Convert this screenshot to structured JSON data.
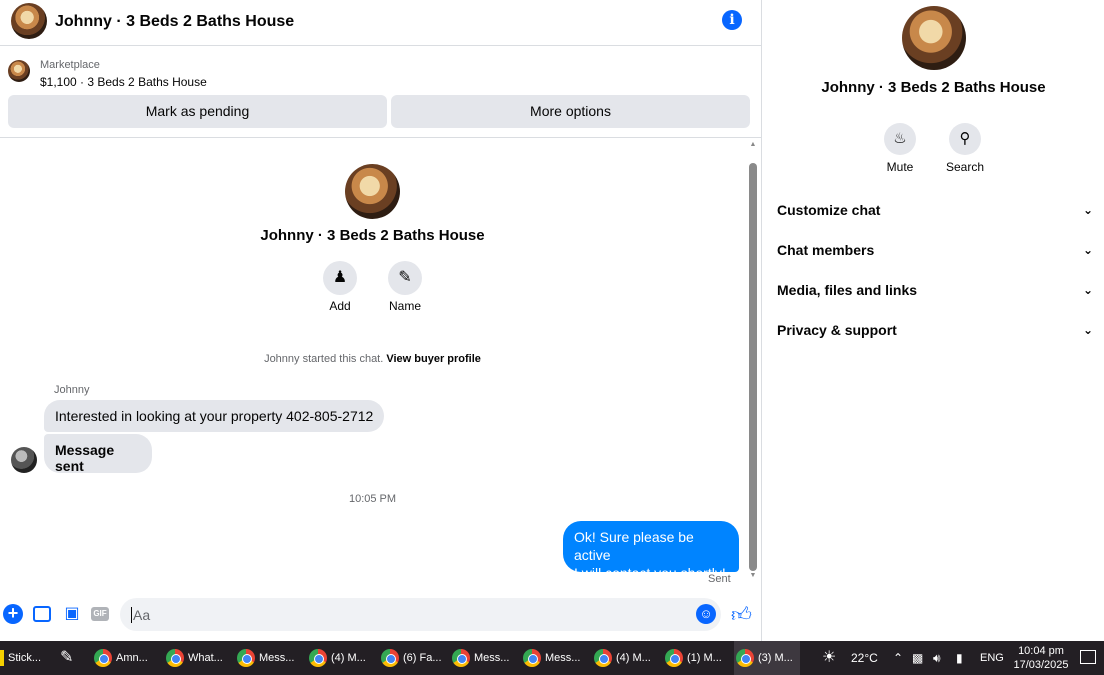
{
  "chat": {
    "header_title": "Johnny · 3 Beds 2 Baths House",
    "marketplace_label": "Marketplace",
    "listing": "$1,100 · 3 Beds 2 Baths House",
    "mark_pending_label": "Mark as pending",
    "more_options_label": "More options"
  },
  "thread": {
    "title": "Johnny · 3 Beds 2 Baths House",
    "add_label": "Add",
    "name_label": "Name",
    "started_text": "Johnny started this chat.",
    "view_profile_link": "View buyer profile",
    "sender_name": "Johnny",
    "messages": [
      {
        "text": "Interested in looking at your property 402-805-2712",
        "direction": "in"
      },
      {
        "text": "Message sent",
        "direction": "in"
      },
      {
        "text": "Ok! Sure please be active\nI will contact you shortly!",
        "direction": "out"
      }
    ],
    "timestamp": "10:05 PM",
    "sent_status": "Sent"
  },
  "composer": {
    "placeholder": "Aa",
    "gif_label": "GIF"
  },
  "details": {
    "title": "Johnny · 3 Beds 2 Baths House",
    "mute_label": "Mute",
    "search_label": "Search",
    "sections": [
      "Customize chat",
      "Chat members",
      "Media, files and links",
      "Privacy & support"
    ]
  },
  "taskbar": {
    "items": [
      "Stick...",
      "",
      "Amn...",
      "What...",
      "Mess...",
      "(4) M...",
      "(6) Fa...",
      "Mess...",
      "Mess...",
      "(4) M...",
      "(1) M...",
      "(3) M..."
    ],
    "weather": "22°C",
    "language": "ENG",
    "time": "10:04 pm",
    "date": "17/03/2025"
  },
  "colors": {
    "accent": "#0866ff",
    "outgoing_bubble": "#0084ff",
    "incoming_bubble": "#e4e6eb",
    "taskbar": "#231f24"
  }
}
